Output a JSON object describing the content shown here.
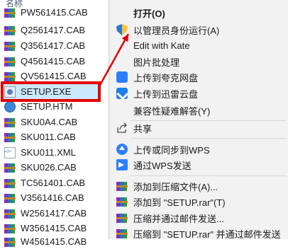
{
  "file_list": {
    "column_header": "名称",
    "files": [
      {
        "name": "PW561415.CAB",
        "icon": "winrar-archive-icon"
      },
      {
        "name": "Q2561417.CAB",
        "icon": "winrar-archive-icon"
      },
      {
        "name": "Q3561417.CAB",
        "icon": "winrar-archive-icon"
      },
      {
        "name": "Q4561415.CAB",
        "icon": "winrar-archive-icon"
      },
      {
        "name": "QV561415.CAB",
        "icon": "winrar-archive-icon"
      },
      {
        "name": "SETUP.EXE",
        "icon": "setup-exe-icon",
        "selected": true
      },
      {
        "name": "SETUP.HTM",
        "icon": "html-file-icon"
      },
      {
        "name": "SKU0A4.CAB",
        "icon": "winrar-archive-icon"
      },
      {
        "name": "SKU011.CAB",
        "icon": "winrar-archive-icon"
      },
      {
        "name": "SKU011.XML",
        "icon": "xml-file-icon"
      },
      {
        "name": "SKU026.CAB",
        "icon": "winrar-archive-icon"
      },
      {
        "name": "TC561401.CAB",
        "icon": "winrar-archive-icon"
      },
      {
        "name": "V3561416.CAB",
        "icon": "winrar-archive-icon"
      },
      {
        "name": "W2561417.CAB",
        "icon": "winrar-archive-icon"
      },
      {
        "name": "W3561415.CAB",
        "icon": "winrar-archive-icon"
      },
      {
        "name": "W4561415.CAB",
        "icon": "winrar-archive-icon"
      }
    ]
  },
  "context_menu": {
    "items": [
      {
        "label": "打开(O)",
        "bold": true,
        "icon": ""
      },
      {
        "label": "以管理员身份运行(A)",
        "icon": "uac-shield-icon"
      },
      {
        "label": "Edit with Kate",
        "icon": ""
      },
      {
        "label": "图片批处理",
        "icon": ""
      },
      {
        "label": "上传到夸克网盘",
        "icon": "quark-icon"
      },
      {
        "label": "上传到迅雷云盘",
        "icon": "xunlei-icon"
      },
      {
        "label": "兼容性疑难解答(Y)",
        "icon": ""
      },
      {
        "label": "共享",
        "icon": "share-icon"
      },
      {
        "label": "上传或同步到WPS",
        "icon": "wps-cloud-icon"
      },
      {
        "label": "通过WPS发送",
        "icon": "wps-send-icon"
      },
      {
        "label": "添加到压缩文件(A)...",
        "icon": "winrar-archive-icon"
      },
      {
        "label": "添加到 \"SETUP.rar\"(T)",
        "icon": "winrar-archive-icon"
      },
      {
        "label": "压缩并通过邮件发送...",
        "icon": "winrar-archive-icon"
      },
      {
        "label": "压缩到 \"SETUP.rar\" 并通过邮件发送",
        "icon": "winrar-archive-icon"
      }
    ]
  },
  "colors": {
    "highlight_box": "#e30000",
    "arrow": "#e30000",
    "selection": "#cce8ff",
    "menu_background": "#f2f2f2"
  }
}
